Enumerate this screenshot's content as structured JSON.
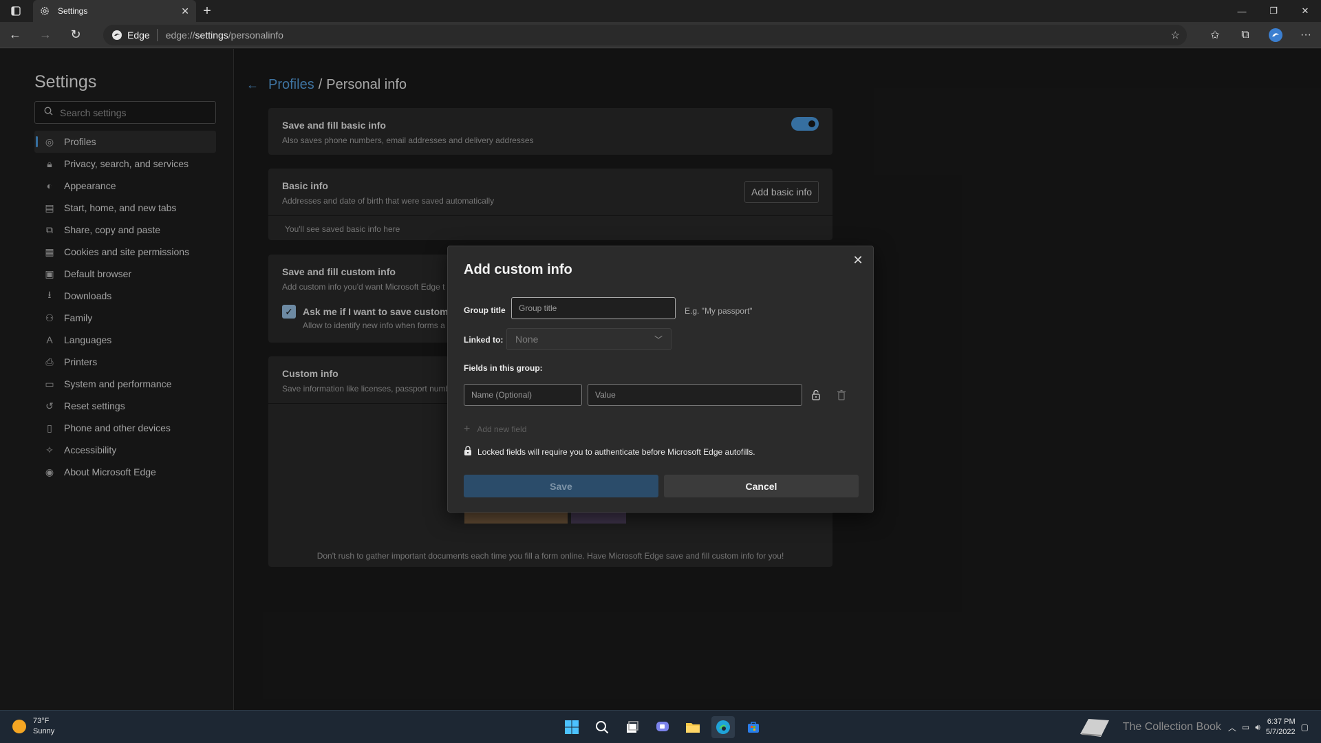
{
  "browser": {
    "tab_title": "Settings",
    "chip_label": "Edge",
    "url_prefix": "edge://",
    "url_host": "settings",
    "url_path": "/personalinfo"
  },
  "sidebar": {
    "title": "Settings",
    "search_placeholder": "Search settings",
    "items": [
      {
        "label": "Profiles",
        "icon": "profile-icon",
        "active": true
      },
      {
        "label": "Privacy, search, and services",
        "icon": "lock-icon"
      },
      {
        "label": "Appearance",
        "icon": "appearance-icon"
      },
      {
        "label": "Start, home, and new tabs",
        "icon": "home-tabs-icon"
      },
      {
        "label": "Share, copy and paste",
        "icon": "share-icon"
      },
      {
        "label": "Cookies and site permissions",
        "icon": "cookies-icon"
      },
      {
        "label": "Default browser",
        "icon": "browser-icon"
      },
      {
        "label": "Downloads",
        "icon": "download-icon"
      },
      {
        "label": "Family",
        "icon": "family-icon"
      },
      {
        "label": "Languages",
        "icon": "languages-icon"
      },
      {
        "label": "Printers",
        "icon": "printer-icon"
      },
      {
        "label": "System and performance",
        "icon": "system-icon"
      },
      {
        "label": "Reset settings",
        "icon": "reset-icon"
      },
      {
        "label": "Phone and other devices",
        "icon": "phone-icon"
      },
      {
        "label": "Accessibility",
        "icon": "accessibility-icon"
      },
      {
        "label": "About Microsoft Edge",
        "icon": "edge-icon"
      }
    ]
  },
  "breadcrumb": {
    "parent": "Profiles",
    "separator": "/",
    "current": "Personal info"
  },
  "cards": {
    "basic_toggle": {
      "title": "Save and fill basic info",
      "subtitle": "Also saves phone numbers, email addresses and delivery addresses",
      "enabled": true
    },
    "basic_info": {
      "title": "Basic info",
      "subtitle": "Addresses and date of birth that were saved automatically",
      "button": "Add basic info",
      "empty_text": "You'll see saved basic info here"
    },
    "custom_toggle": {
      "title": "Save and fill custom info",
      "subtitle": "Add custom info you'd want Microsoft Edge t",
      "checkbox_label": "Ask me if I want to save custom i",
      "checkbox_sub": "Allow to identify new info when forms a",
      "checked": true
    },
    "custom_info": {
      "title": "Custom info",
      "subtitle": "Save information like licenses, passport numb",
      "footer": "Don't rush to gather important documents each time you fill a form online. Have Microsoft Edge save and fill custom info for you!"
    }
  },
  "dialog": {
    "title": "Add custom info",
    "group_title_label": "Group title",
    "group_title_placeholder": "Group title",
    "group_title_hint": "E.g. \"My passport\"",
    "linked_label": "Linked to:",
    "linked_value": "None",
    "fields_label": "Fields in this group:",
    "name_placeholder": "Name (Optional)",
    "value_placeholder": "Value",
    "add_field": "Add new field",
    "lock_note": "Locked fields will require you to authenticate before Microsoft Edge autofills.",
    "save_button": "Save",
    "cancel_button": "Cancel"
  },
  "taskbar": {
    "temperature": "73°F",
    "condition": "Sunny",
    "watermark": "The Collection Book",
    "time": "6:37 PM",
    "date": "5/7/2022"
  },
  "colors": {
    "accent": "#4ea0e6",
    "save_disabled_bg": "#2b4c6a"
  }
}
